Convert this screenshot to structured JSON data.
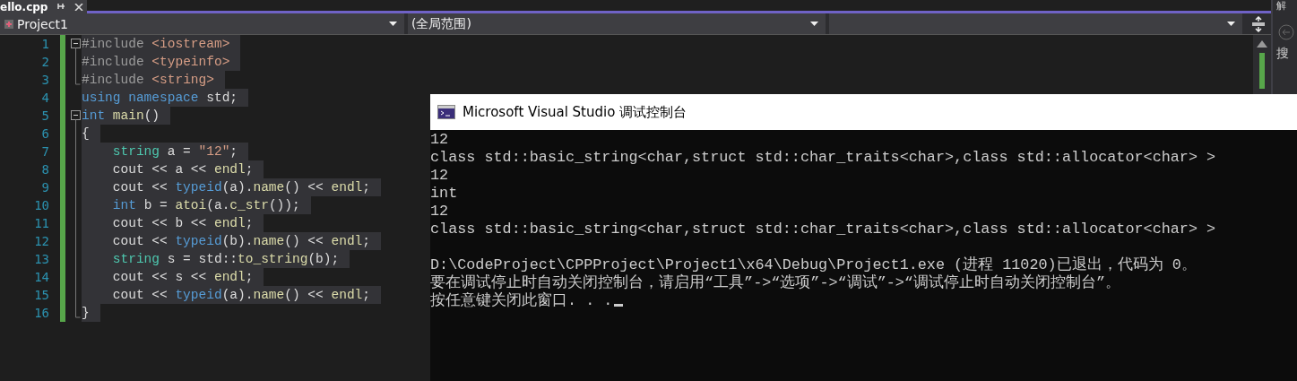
{
  "document_tab": {
    "title": "ello.cpp",
    "selected": true
  },
  "side_panel": {
    "title": "解",
    "search_label": "搜"
  },
  "navigation_bar": {
    "dropdowns": [
      {
        "value": "Project1",
        "kind": "project"
      },
      {
        "value": "(全局范围)",
        "kind": "plain"
      },
      {
        "kind": "plain"
      }
    ]
  },
  "editor": {
    "lines": [
      {
        "number": "1",
        "kind": "start",
        "tokens": [
          {
            "text": "#include ",
            "kind": "macro"
          },
          {
            "text": "<iostream>",
            "kind": "string"
          }
        ]
      },
      {
        "number": "2",
        "kind": "line",
        "tokens": [
          {
            "text": "#include ",
            "kind": "macro"
          },
          {
            "text": "<typeinfo>",
            "kind": "string"
          }
        ]
      },
      {
        "number": "3",
        "kind": "end",
        "tokens": [
          {
            "text": "#include ",
            "kind": "macro"
          },
          {
            "text": "<string>",
            "kind": "string"
          }
        ]
      },
      {
        "number": "4",
        "kind": "none",
        "tokens": [
          {
            "text": "using namespace ",
            "kind": "keyword"
          },
          {
            "text": "std;",
            "kind": "plain"
          }
        ]
      },
      {
        "number": "5",
        "kind": "start",
        "tokens": [
          {
            "text": "int ",
            "kind": "keyword"
          },
          {
            "text": "main",
            "kind": "func"
          },
          {
            "text": "()",
            "kind": "plain"
          }
        ]
      },
      {
        "number": "6",
        "kind": "line",
        "tokens": [
          {
            "text": "{",
            "kind": "plain"
          }
        ]
      },
      {
        "number": "7",
        "kind": "line",
        "tokens": [
          {
            "text": "    string ",
            "kind": "type"
          },
          {
            "text": "a = ",
            "kind": "plain"
          },
          {
            "text": "\"12\"",
            "kind": "string"
          },
          {
            "text": ";",
            "kind": "plain"
          }
        ]
      },
      {
        "number": "8",
        "kind": "line",
        "tokens": [
          {
            "text": "    cout << a << ",
            "kind": "plain"
          },
          {
            "text": "endl",
            "kind": "func"
          },
          {
            "text": ";",
            "kind": "plain"
          }
        ]
      },
      {
        "number": "9",
        "kind": "line",
        "tokens": [
          {
            "text": "    cout << ",
            "kind": "plain"
          },
          {
            "text": "typeid",
            "kind": "keyword"
          },
          {
            "text": "(a).",
            "kind": "plain"
          },
          {
            "text": "name",
            "kind": "func"
          },
          {
            "text": "() << ",
            "kind": "plain"
          },
          {
            "text": "endl",
            "kind": "func"
          },
          {
            "text": ";",
            "kind": "plain"
          }
        ]
      },
      {
        "number": "10",
        "kind": "line",
        "tokens": [
          {
            "text": "    int ",
            "kind": "keyword"
          },
          {
            "text": "b = ",
            "kind": "plain"
          },
          {
            "text": "atoi",
            "kind": "func"
          },
          {
            "text": "(a.",
            "kind": "plain"
          },
          {
            "text": "c_str",
            "kind": "func"
          },
          {
            "text": "());",
            "kind": "plain"
          }
        ]
      },
      {
        "number": "11",
        "kind": "line",
        "tokens": [
          {
            "text": "    cout << b << ",
            "kind": "plain"
          },
          {
            "text": "endl",
            "kind": "func"
          },
          {
            "text": ";",
            "kind": "plain"
          }
        ]
      },
      {
        "number": "12",
        "kind": "line",
        "tokens": [
          {
            "text": "    cout << ",
            "kind": "plain"
          },
          {
            "text": "typeid",
            "kind": "keyword"
          },
          {
            "text": "(b).",
            "kind": "plain"
          },
          {
            "text": "name",
            "kind": "func"
          },
          {
            "text": "() << ",
            "kind": "plain"
          },
          {
            "text": "endl",
            "kind": "func"
          },
          {
            "text": ";",
            "kind": "plain"
          }
        ]
      },
      {
        "number": "13",
        "kind": "line",
        "tokens": [
          {
            "text": "    string ",
            "kind": "type"
          },
          {
            "text": "s = std::",
            "kind": "plain"
          },
          {
            "text": "to_string",
            "kind": "func"
          },
          {
            "text": "(b);",
            "kind": "plain"
          }
        ]
      },
      {
        "number": "14",
        "kind": "line",
        "tokens": [
          {
            "text": "    cout << s << ",
            "kind": "plain"
          },
          {
            "text": "endl",
            "kind": "func"
          },
          {
            "text": ";",
            "kind": "plain"
          }
        ]
      },
      {
        "number": "15",
        "kind": "line",
        "tokens": [
          {
            "text": "    cout << ",
            "kind": "plain"
          },
          {
            "text": "typeid",
            "kind": "keyword"
          },
          {
            "text": "(a).",
            "kind": "plain"
          },
          {
            "text": "name",
            "kind": "func"
          },
          {
            "text": "() << ",
            "kind": "plain"
          },
          {
            "text": "endl",
            "kind": "func"
          },
          {
            "text": ";",
            "kind": "plain"
          }
        ]
      },
      {
        "number": "16",
        "kind": "end",
        "tokens": [
          {
            "text": "}",
            "kind": "plain"
          }
        ]
      }
    ]
  },
  "console_window": {
    "title": "Microsoft Visual Studio 调试控制台",
    "output_lines": [
      "12",
      "class std::basic_string<char,struct std::char_traits<char>,class std::allocator<char> >",
      "12",
      "int",
      "12",
      "class std::basic_string<char,struct std::char_traits<char>,class std::allocator<char> >"
    ],
    "exit_messages": [
      "D:\\CodeProject\\CPPProject\\Project1\\x64\\Debug\\Project1.exe (进程 11020)已退出，代码为 0。",
      "要在调试停止时自动关闭控制台，请启用“工具”->“选项”->“调试”->“调试停止时自动关闭控制台”。",
      "按任意键关闭此窗口. . ."
    ]
  }
}
